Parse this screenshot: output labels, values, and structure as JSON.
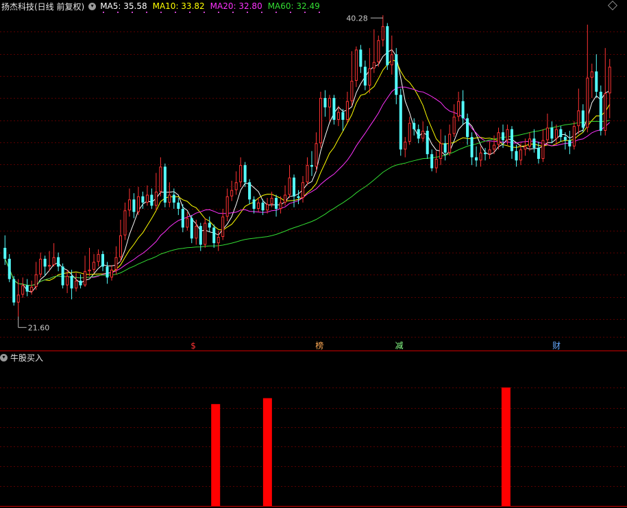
{
  "header": {
    "title": "扬杰科技(日线 前复权)",
    "ma": [
      {
        "label": "MA5: 35.58",
        "color": "#ffffff"
      },
      {
        "label": "MA10: 33.82",
        "color": "#ffff00"
      },
      {
        "label": "MA20: 32.80",
        "color": "#ff33ff"
      },
      {
        "label": "MA60: 32.49",
        "color": "#33dd33"
      }
    ]
  },
  "sub_panel": {
    "title": "牛股买入"
  },
  "colors": {
    "up": "#ff3333",
    "down": "#54ffff",
    "grid": "#5a0000",
    "separator": "#cc0000",
    "ma5": "#ffffff",
    "ma10": "#ffff00",
    "ma20": "#ff33ff",
    "ma60": "#33dd33",
    "signal_bar": "#ff0000"
  },
  "chart_data": [
    {
      "type": "candlestick",
      "title": "扬杰科技(日线 前复权)",
      "annotations": [
        {
          "text": "40.28",
          "kind": "high"
        },
        {
          "text": "21.60",
          "kind": "low"
        }
      ],
      "markers": [
        {
          "text": "$",
          "color": "#ff3333"
        },
        {
          "text": "榜",
          "color": "#ffaa55"
        },
        {
          "text": "减",
          "color": "#88ff88"
        },
        {
          "text": "财",
          "color": "#66aaff"
        }
      ],
      "ylim": [
        21.0,
        41.0
      ],
      "candles": [
        [
          26.0,
          25.3,
          26.8,
          24.9
        ],
        [
          25.3,
          24.0,
          25.6,
          23.8
        ],
        [
          24.0,
          22.5,
          24.2,
          22.3
        ],
        [
          22.5,
          23.0,
          24.0,
          21.6
        ],
        [
          23.0,
          23.6,
          24.1,
          22.8
        ],
        [
          23.6,
          23.2,
          24.0,
          22.9
        ],
        [
          23.2,
          23.5,
          23.9,
          23.0
        ],
        [
          23.5,
          24.3,
          25.1,
          23.3
        ],
        [
          24.3,
          25.3,
          25.7,
          24.1
        ],
        [
          25.3,
          24.8,
          25.5,
          24.2
        ],
        [
          24.8,
          24.9,
          25.8,
          24.5
        ],
        [
          24.9,
          25.4,
          26.3,
          24.8
        ],
        [
          25.4,
          24.8,
          25.7,
          24.5
        ],
        [
          24.8,
          23.6,
          25.0,
          23.4
        ],
        [
          23.6,
          24.2,
          24.6,
          23.1
        ],
        [
          24.2,
          23.4,
          24.6,
          22.7
        ],
        [
          23.4,
          23.9,
          24.4,
          23.2
        ],
        [
          23.9,
          23.6,
          24.3,
          23.4
        ],
        [
          23.6,
          24.5,
          25.5,
          23.5
        ],
        [
          24.5,
          24.6,
          26.0,
          24.2
        ],
        [
          24.6,
          25.1,
          25.6,
          24.4
        ],
        [
          25.1,
          25.6,
          25.9,
          24.8
        ],
        [
          25.6,
          24.8,
          25.8,
          24.5
        ],
        [
          24.8,
          24.1,
          25.1,
          23.7
        ],
        [
          24.1,
          24.6,
          24.9,
          23.9
        ],
        [
          24.6,
          25.4,
          26.1,
          24.3
        ],
        [
          25.4,
          26.8,
          27.8,
          25.1
        ],
        [
          26.8,
          28.4,
          28.9,
          26.5
        ],
        [
          28.4,
          29.1,
          29.8,
          28.0
        ],
        [
          29.1,
          28.3,
          29.5,
          27.9
        ],
        [
          28.3,
          29.3,
          29.9,
          28.1
        ],
        [
          29.3,
          28.9,
          29.6,
          28.5
        ],
        [
          28.9,
          29.4,
          30.0,
          28.7
        ],
        [
          29.4,
          28.7,
          29.8,
          28.5
        ],
        [
          28.7,
          29.6,
          30.8,
          28.4
        ],
        [
          29.6,
          31.2,
          31.8,
          29.3
        ],
        [
          31.2,
          28.9,
          31.4,
          28.6
        ],
        [
          28.9,
          29.4,
          30.2,
          28.6
        ],
        [
          29.4,
          28.9,
          29.8,
          28.5
        ],
        [
          28.9,
          28.5,
          29.2,
          28.1
        ],
        [
          28.5,
          27.3,
          28.8,
          27.0
        ],
        [
          27.3,
          27.9,
          28.3,
          27.1
        ],
        [
          27.9,
          26.6,
          28.1,
          26.3
        ],
        [
          26.6,
          27.4,
          27.8,
          26.2
        ],
        [
          27.4,
          26.2,
          27.6,
          25.8
        ],
        [
          26.2,
          27.6,
          27.9,
          26.0
        ],
        [
          27.6,
          27.3,
          28.0,
          27.0
        ],
        [
          27.3,
          26.3,
          27.5,
          26.0
        ],
        [
          26.3,
          26.7,
          27.1,
          25.8
        ],
        [
          26.7,
          28.0,
          28.5,
          26.5
        ],
        [
          28.0,
          29.3,
          29.8,
          27.7
        ],
        [
          29.3,
          29.7,
          30.3,
          29.0
        ],
        [
          29.7,
          30.2,
          30.9,
          29.4
        ],
        [
          30.2,
          31.3,
          31.8,
          29.9
        ],
        [
          31.3,
          30.2,
          31.5,
          29.9
        ],
        [
          30.2,
          29.1,
          30.4,
          28.8
        ],
        [
          29.1,
          28.5,
          29.3,
          28.2
        ],
        [
          28.5,
          28.9,
          29.2,
          28.3
        ],
        [
          28.9,
          28.4,
          29.1,
          28.1
        ],
        [
          28.4,
          28.8,
          29.2,
          28.2
        ],
        [
          28.8,
          29.2,
          29.6,
          28.6
        ],
        [
          29.2,
          28.5,
          29.4,
          28.0
        ],
        [
          28.5,
          28.9,
          29.3,
          28.2
        ],
        [
          28.9,
          29.4,
          30.0,
          28.7
        ],
        [
          29.4,
          30.5,
          31.3,
          29.2
        ],
        [
          30.5,
          29.3,
          30.7,
          28.6
        ],
        [
          29.3,
          29.2,
          29.7,
          28.8
        ],
        [
          29.2,
          30.2,
          30.6,
          28.9
        ],
        [
          30.2,
          31.3,
          31.8,
          30.0
        ],
        [
          31.3,
          31.2,
          32.2,
          30.6
        ],
        [
          31.2,
          32.7,
          33.4,
          30.9
        ],
        [
          32.7,
          35.6,
          36.0,
          32.4
        ],
        [
          35.6,
          35.0,
          36.1,
          34.4
        ],
        [
          35.0,
          35.6,
          35.8,
          34.1
        ],
        [
          35.6,
          34.2,
          35.8,
          33.9
        ],
        [
          34.2,
          34.7,
          35.1,
          33.8
        ],
        [
          34.7,
          34.2,
          34.9,
          33.5
        ],
        [
          34.2,
          35.4,
          36.0,
          34.0
        ],
        [
          35.4,
          36.7,
          38.6,
          35.1
        ],
        [
          36.7,
          38.7,
          38.9,
          36.3
        ],
        [
          38.7,
          37.6,
          39.0,
          37.2
        ],
        [
          37.6,
          36.4,
          38.0,
          36.1
        ],
        [
          36.4,
          37.5,
          38.8,
          35.9
        ],
        [
          37.5,
          37.9,
          40.0,
          37.2
        ],
        [
          37.9,
          39.3,
          39.6,
          37.6
        ],
        [
          39.3,
          40.2,
          40.9,
          38.9
        ],
        [
          40.2,
          37.7,
          40.4,
          37.4
        ],
        [
          37.7,
          38.4,
          39.6,
          37.1
        ],
        [
          38.4,
          35.8,
          38.8,
          35.2
        ],
        [
          35.8,
          32.3,
          36.2,
          31.9
        ],
        [
          32.3,
          32.8,
          33.1,
          31.8
        ],
        [
          32.8,
          34.0,
          34.4,
          32.6
        ],
        [
          34.0,
          33.6,
          34.3,
          33.2
        ],
        [
          33.6,
          33.0,
          33.9,
          32.7
        ],
        [
          33.0,
          33.5,
          34.1,
          32.8
        ],
        [
          33.5,
          32.0,
          33.8,
          31.7
        ],
        [
          32.0,
          31.1,
          32.3,
          30.9
        ],
        [
          31.1,
          31.7,
          32.2,
          30.8
        ],
        [
          31.7,
          32.7,
          33.6,
          31.3
        ],
        [
          32.7,
          32.1,
          33.2,
          31.6
        ],
        [
          32.1,
          33.3,
          33.9,
          31.9
        ],
        [
          33.3,
          34.4,
          35.2,
          33.1
        ],
        [
          34.4,
          35.4,
          36.0,
          34.1
        ],
        [
          35.4,
          34.3,
          36.1,
          33.9
        ],
        [
          34.3,
          33.1,
          34.6,
          32.6
        ],
        [
          33.1,
          31.8,
          33.4,
          31.3
        ],
        [
          31.8,
          31.6,
          32.5,
          31.2
        ],
        [
          31.6,
          32.1,
          32.5,
          31.2
        ],
        [
          32.1,
          32.0,
          32.4,
          31.6
        ],
        [
          32.0,
          32.3,
          32.8,
          31.7
        ],
        [
          32.3,
          32.6,
          33.2,
          32.0
        ],
        [
          32.6,
          33.4,
          33.7,
          32.3
        ],
        [
          33.4,
          32.9,
          33.9,
          32.4
        ],
        [
          32.9,
          33.6,
          33.9,
          32.6
        ],
        [
          33.6,
          32.2,
          33.8,
          31.7
        ],
        [
          32.2,
          31.6,
          32.6,
          31.2
        ],
        [
          31.6,
          32.3,
          32.7,
          31.3
        ],
        [
          32.3,
          32.5,
          33.0,
          31.9
        ],
        [
          32.5,
          33.0,
          33.4,
          32.2
        ],
        [
          33.0,
          32.4,
          33.6,
          32.1
        ],
        [
          32.4,
          31.7,
          32.8,
          31.4
        ],
        [
          31.7,
          32.9,
          33.6,
          31.5
        ],
        [
          32.9,
          33.7,
          34.6,
          32.6
        ],
        [
          33.7,
          33.0,
          34.1,
          32.7
        ],
        [
          33.0,
          33.6,
          33.9,
          32.6
        ],
        [
          33.6,
          33.1,
          33.8,
          32.8
        ],
        [
          33.1,
          32.9,
          33.4,
          32.3
        ],
        [
          32.9,
          32.5,
          33.5,
          32.0
        ],
        [
          32.5,
          33.8,
          34.1,
          32.3
        ],
        [
          33.8,
          34.8,
          36.2,
          33.3
        ],
        [
          34.8,
          33.7,
          35.2,
          33.4
        ],
        [
          33.7,
          36.9,
          40.3,
          33.4
        ],
        [
          36.9,
          37.3,
          37.8,
          35.6
        ],
        [
          37.3,
          36.0,
          38.4,
          35.6
        ],
        [
          36.0,
          33.5,
          36.4,
          33.2
        ],
        [
          33.5,
          35.9,
          38.8,
          33.2
        ],
        [
          35.9,
          37.6,
          38.1,
          34.3
        ]
      ]
    },
    {
      "type": "bar",
      "title": "牛股买入",
      "signal_indices": [
        82,
        102,
        194
      ],
      "values": [
        0.86,
        0.91,
        1.0
      ]
    }
  ]
}
